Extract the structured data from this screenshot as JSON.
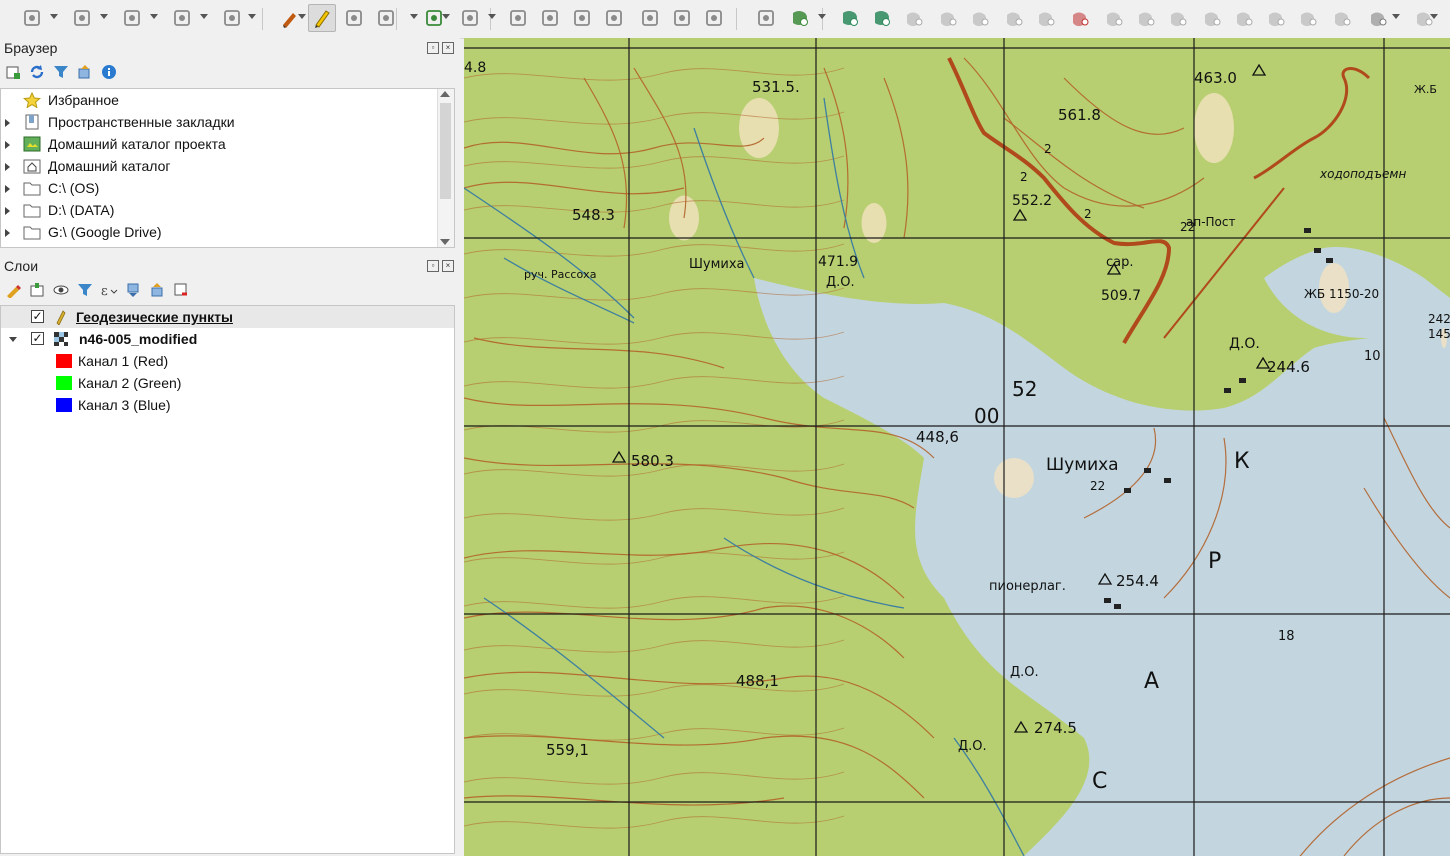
{
  "colors": {
    "forest": "#b7cf70",
    "water": "#c3d6df",
    "contour": "#b3622a",
    "grid": "#1b1b1b",
    "road": "#b04a1c",
    "stream": "#3d7fa0"
  },
  "toolbar": {
    "icons": [
      "new-project-icon",
      "open-project-icon",
      "save-project-icon",
      "layout-icon",
      "style-manager-icon",
      "digitize-icon",
      "edit-pencil-icon",
      "save-edits-icon",
      "add-line-icon",
      "add-point-icon",
      "vertex-tool-icon",
      "table-icon",
      "delete-icon",
      "cut-icon",
      "copy-icon",
      "paste-icon",
      "undo-icon",
      "redo-icon",
      "snap-icon",
      "add-feature-icon",
      "shape-add-icon",
      "shape-rotate-icon",
      "shape-merge-icon",
      "shape-split-icon",
      "shape-fill-icon",
      "shape-simplify-icon",
      "shape-ring-icon",
      "shape-delete-icon",
      "shape-offset-icon",
      "shape-reshape-icon",
      "shape-reverse-icon",
      "shape-scale-icon",
      "shape-cut-icon",
      "shape-cut2-icon",
      "shape-reflect-icon",
      "shape-align-icon",
      "shape-curve-icon",
      "shape-extra-icon"
    ]
  },
  "browser": {
    "title": "Браузер",
    "items": [
      {
        "label": "Избранное",
        "icon": "star-icon",
        "expandable": false
      },
      {
        "label": "Пространственные закладки",
        "icon": "bookmark-icon",
        "expandable": true
      },
      {
        "label": "Домашний каталог проекта",
        "icon": "project-home-icon",
        "expandable": true
      },
      {
        "label": "Домашний каталог",
        "icon": "home-folder-icon",
        "expandable": true
      },
      {
        "label": "C:\\ (OS)",
        "icon": "folder-icon",
        "expandable": true
      },
      {
        "label": "D:\\ (DATA)",
        "icon": "folder-icon",
        "expandable": true
      },
      {
        "label": "G:\\ (Google Drive)",
        "icon": "folder-icon",
        "expandable": true
      }
    ]
  },
  "layers": {
    "title": "Слои",
    "items": [
      {
        "label": "Геодезические пункты",
        "checked": true
      },
      {
        "label": "n46-005_modified",
        "checked": true
      }
    ],
    "bands": [
      {
        "label": "Канал 1 (Red)",
        "color": "#ff0000"
      },
      {
        "label": "Канал 2 (Green)",
        "color": "#00ff00"
      },
      {
        "label": "Канал 3 (Blue)",
        "color": "#0000ff"
      }
    ]
  },
  "map": {
    "labels": [
      "4.8",
      "531.5.",
      "561.8",
      "463.0",
      "548.3",
      "552.2",
      "471.9",
      "Д.О.",
      "509.7",
      "сар.",
      "22",
      "ЖБ 1150-20",
      "Д.О.",
      "244.6",
      "10",
      "580.3",
      "448,6",
      "00",
      "52",
      "Шумиха",
      "22",
      "пионерлаг.",
      "254.4",
      "18",
      "Д.О.",
      "488,1",
      "274.5",
      "Д.О.",
      "559,1",
      "Шумиха",
      "руч. Рассоха",
      "Ж.Б",
      "ходоподъемн",
      "ап-Пост",
      "2",
      "2",
      "2",
      "К",
      "Р",
      "А",
      "С",
      "242",
      "145"
    ]
  }
}
